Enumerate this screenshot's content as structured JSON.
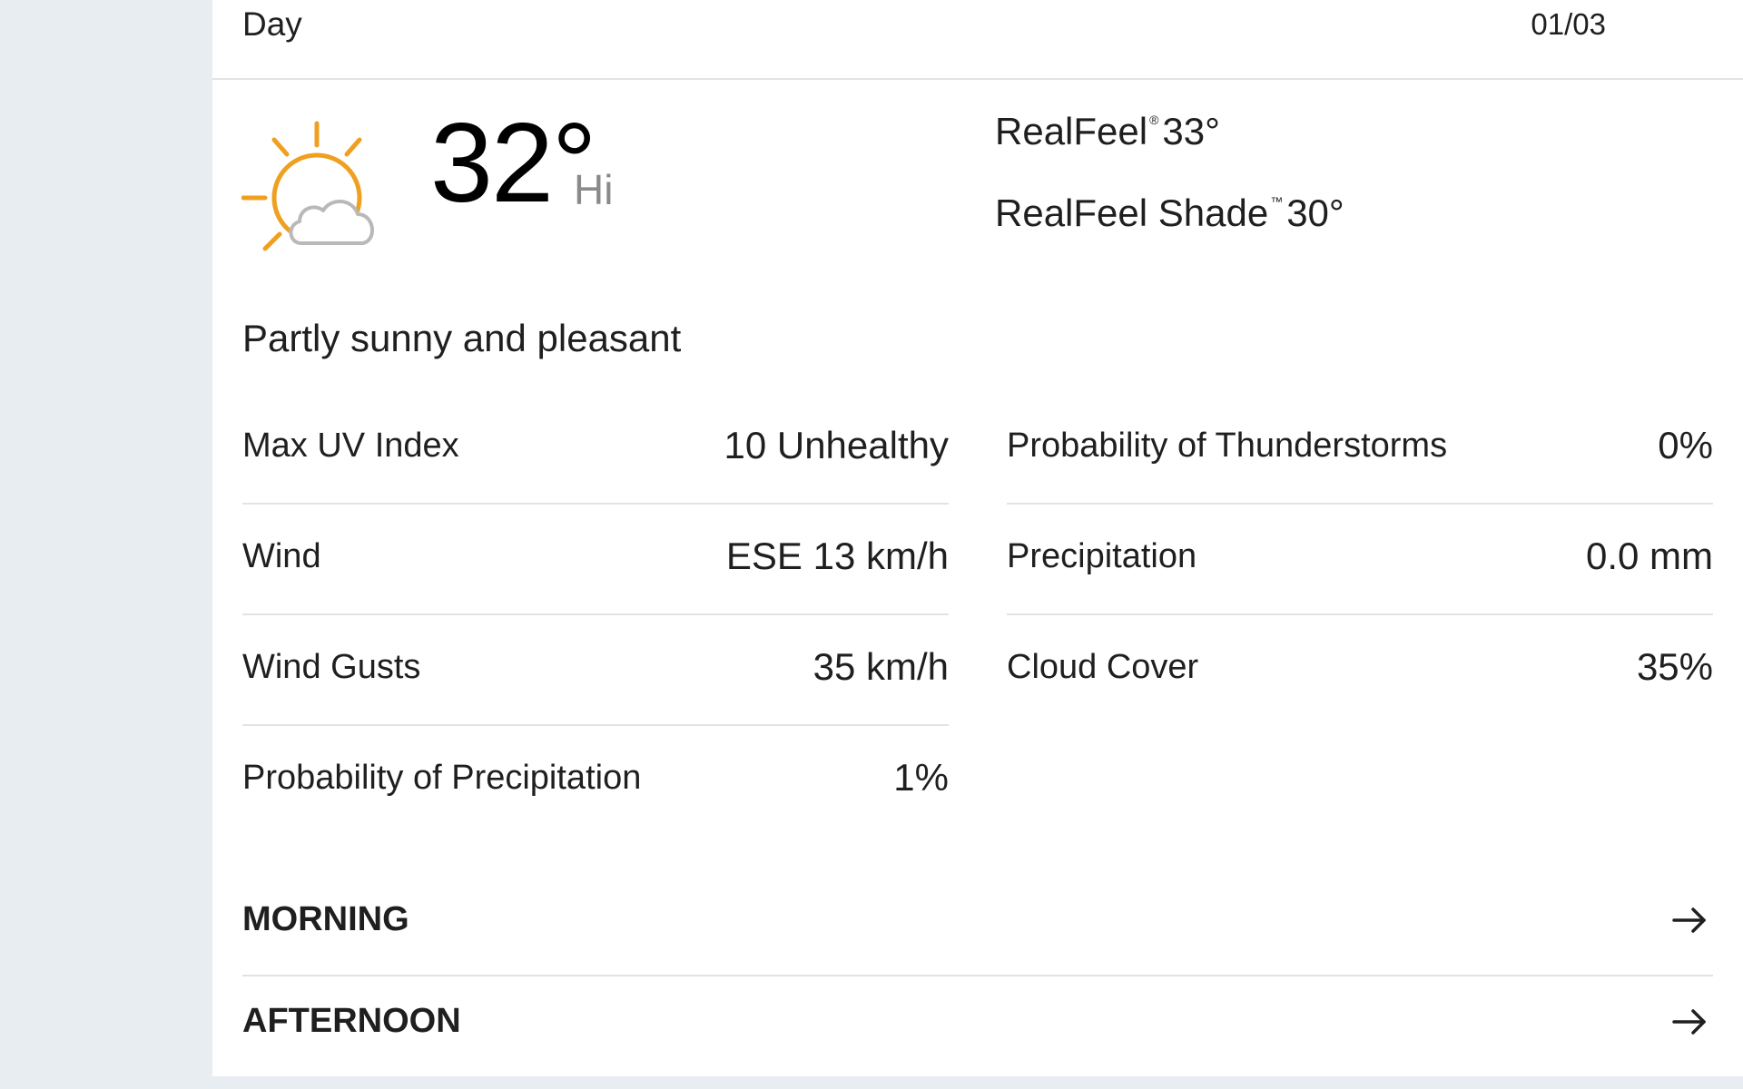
{
  "header": {
    "day_label": "Day",
    "date": "01/03"
  },
  "current": {
    "icon": "partly-sunny-icon",
    "temperature": "32°",
    "temp_suffix": "Hi",
    "realfeel_label": "RealFeel",
    "realfeel_mark": "®",
    "realfeel_value": "33°",
    "realfeel_shade_label": "RealFeel Shade",
    "realfeel_shade_mark": "™",
    "realfeel_shade_value": "30°",
    "phrase": "Partly sunny and pleasant"
  },
  "details": {
    "left": [
      {
        "label": "Max UV Index",
        "value": "10 Unhealthy"
      },
      {
        "label": "Wind",
        "value": "ESE 13 km/h"
      },
      {
        "label": "Wind Gusts",
        "value": "35 km/h"
      },
      {
        "label": "Probability of Precipitation",
        "value": "1%"
      }
    ],
    "right": [
      {
        "label": "Probability of Thunderstorms",
        "value": "0%"
      },
      {
        "label": "Precipitation",
        "value": "0.0 mm"
      },
      {
        "label": "Cloud Cover",
        "value": "35%"
      }
    ]
  },
  "sections": {
    "morning": "MORNING",
    "afternoon": "AFTERNOON"
  },
  "colors": {
    "sun": "#f0a020",
    "cloud_stroke": "#b9b9b9",
    "divider": "#e3e3e3",
    "background": "#e8edf2"
  }
}
